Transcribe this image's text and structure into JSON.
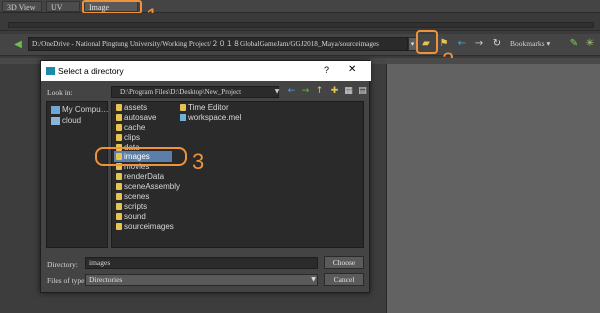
{
  "tabs": [
    {
      "label": "3D View"
    },
    {
      "label": "UV View"
    },
    {
      "label": "Image Browser"
    }
  ],
  "callouts": [
    "1",
    "2",
    "3"
  ],
  "toolbar": {
    "path": "D:/OneDrive - National Pingtung University/Working Project/２０１８GlobalGameJam/GGJ2018_Maya/sourceimages",
    "bookmarks_label": "Bookmarks"
  },
  "dialog": {
    "title": "Select a directory",
    "help": "?",
    "close": "✕",
    "look_in_label": "Look in:",
    "look_in_value": "D:\\Program Files\\D:\\Desktop\\New_Project",
    "sidebar": [
      {
        "label": "My Compu…",
        "icon": "computer-icon"
      },
      {
        "label": "cloud",
        "icon": "cloud-icon"
      }
    ],
    "folders_col1": [
      "assets",
      "autosave",
      "cache",
      "clips",
      "data",
      "images",
      "movies",
      "renderData",
      "sceneAssembly",
      "scenes",
      "scripts",
      "sound",
      "sourceimages"
    ],
    "col2": [
      {
        "label": "Time Editor",
        "type": "folder"
      },
      {
        "label": "workspace.mel",
        "type": "file"
      }
    ],
    "selected": "images",
    "directory_label": "Directory:",
    "directory_value": "images",
    "choose_label": "Choose",
    "files_of_type_label": "Files of type:",
    "files_of_type_value": "Directories",
    "cancel_label": "Cancel"
  },
  "colors": {
    "highlight": "#f0923a",
    "selection": "#5b7fa8",
    "folder": "#e6c453"
  }
}
